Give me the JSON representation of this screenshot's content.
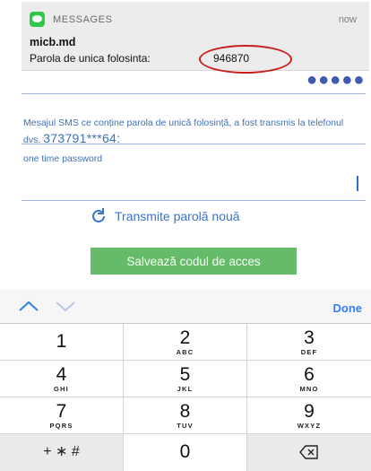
{
  "notification": {
    "app": "MESSAGES",
    "time": "now",
    "sender": "micb.md",
    "body_prefix": "Parola de unica folosinta:",
    "code": "946870",
    "annotation_color": "#c8201e"
  },
  "page": {
    "sms_message": "Mesajul SMS ce conține parola de unică folosință, a fost transmis la telefonul dvs.",
    "masked_phone": "373791***64:",
    "otp_label": "one time password",
    "otp_value": "",
    "resend_label": "Transmite parolă nouă",
    "save_label": "Salvează codul de acces",
    "accent": "#3f72b5",
    "button_color": "#66bb6a"
  },
  "keyboard": {
    "done": "Done",
    "keys": [
      {
        "num": "1",
        "letters": ""
      },
      {
        "num": "2",
        "letters": "ABC"
      },
      {
        "num": "3",
        "letters": "DEF"
      },
      {
        "num": "4",
        "letters": "GHI"
      },
      {
        "num": "5",
        "letters": "JKL"
      },
      {
        "num": "6",
        "letters": "MNO"
      },
      {
        "num": "7",
        "letters": "PQRS"
      },
      {
        "num": "8",
        "letters": "TUV"
      },
      {
        "num": "9",
        "letters": "WXYZ"
      },
      {
        "num": "+ ∗ #",
        "letters": ""
      },
      {
        "num": "0",
        "letters": ""
      },
      {
        "num": "backspace-icon",
        "letters": ""
      }
    ]
  }
}
